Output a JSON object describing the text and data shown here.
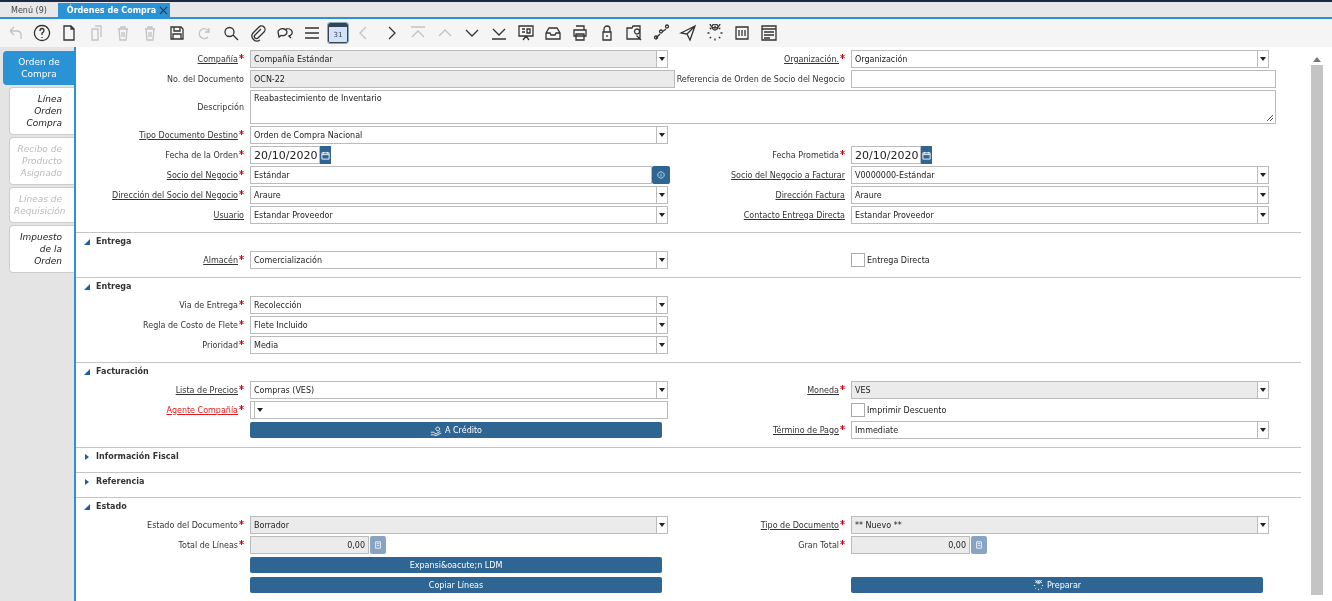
{
  "tabs": [
    {
      "label": "Menú (9)",
      "selected": false
    },
    {
      "label": "Órdenes de Compra",
      "selected": true
    }
  ],
  "toolbar": [
    {
      "kind": "undo",
      "disabled": true
    },
    {
      "kind": "help",
      "disabled": false
    },
    {
      "kind": "new",
      "disabled": false
    },
    {
      "kind": "copy",
      "disabled": true
    },
    {
      "kind": "delete",
      "disabled": true
    },
    {
      "kind": "delete",
      "disabled": true
    },
    {
      "kind": "save",
      "disabled": false
    },
    {
      "kind": "refresh",
      "disabled": true
    },
    {
      "kind": "find",
      "disabled": false
    },
    {
      "kind": "attach",
      "disabled": false
    },
    {
      "kind": "chat",
      "disabled": false
    },
    {
      "kind": "lines",
      "disabled": false
    },
    {
      "kind": "calendar",
      "disabled": false,
      "active": true,
      "label": "31"
    },
    {
      "kind": "prev",
      "disabled": true
    },
    {
      "kind": "next",
      "disabled": false
    },
    {
      "kind": "first",
      "disabled": true
    },
    {
      "kind": "up",
      "disabled": true
    },
    {
      "kind": "down",
      "disabled": false
    },
    {
      "kind": "last",
      "disabled": false
    },
    {
      "kind": "report",
      "disabled": false
    },
    {
      "kind": "archive",
      "disabled": false
    },
    {
      "kind": "print",
      "disabled": false
    },
    {
      "kind": "lock",
      "disabled": false
    },
    {
      "kind": "zoom",
      "disabled": false
    },
    {
      "kind": "workflow",
      "disabled": false
    },
    {
      "kind": "send",
      "disabled": false
    },
    {
      "kind": "gear",
      "disabled": false
    },
    {
      "kind": "product",
      "disabled": false
    },
    {
      "kind": "window",
      "disabled": false
    }
  ],
  "side_tabs": [
    {
      "label": "Orden de Compra",
      "selected": true,
      "disabled": false
    },
    {
      "label": "Línea Orden Compra",
      "selected": false,
      "disabled": false
    },
    {
      "label": "Recibo de Producto Asignado",
      "selected": false,
      "disabled": true
    },
    {
      "label": "Líneas de Requisición",
      "selected": false,
      "disabled": true
    },
    {
      "label": "Impuesto de la Orden",
      "selected": false,
      "disabled": false
    }
  ],
  "sections": [
    {
      "rows": [
        {
          "left": {
            "label": "Compañía",
            "required": true,
            "link": true,
            "kind": "select",
            "value": "Compañía Estándar",
            "readonly": true
          },
          "right": {
            "label": "Organización.",
            "required": true,
            "link": true,
            "kind": "select",
            "value": "Organización",
            "readonly": false
          }
        },
        {
          "left": {
            "label": "No. del Documento",
            "required": false,
            "link": false,
            "kind": "text",
            "value": "OCN-22",
            "readonly": true
          },
          "right": {
            "label": "Referencia de Orden de Socio del Negocio",
            "required": false,
            "link": false,
            "kind": "text",
            "readonly": false
          }
        },
        {
          "left": {
            "label": "Descripción",
            "required": false,
            "link": false,
            "kind": "textarea",
            "value": "Reabastecimiento de Inventario",
            "readonly": false
          }
        },
        {
          "left": {
            "label": "Tipo Documento Destino",
            "required": true,
            "link": true,
            "kind": "select",
            "value": "Orden de Compra Nacional",
            "readonly": false
          }
        },
        {
          "left": {
            "label": "Fecha de la Orden",
            "required": true,
            "link": false,
            "kind": "date",
            "value": "20/10/2020",
            "readonly": false
          },
          "right": {
            "label": "Fecha Prometida",
            "required": true,
            "link": false,
            "kind": "date",
            "value": "20/10/2020",
            "readonly": false
          }
        },
        {
          "left": {
            "label": "Socio del Negocio",
            "required": true,
            "link": true,
            "kind": "search",
            "value": "Estándar",
            "readonly": false
          },
          "right": {
            "label": "Socio del Negocio a Facturar",
            "required": false,
            "link": true,
            "kind": "select",
            "value": "V0000000-Estándar",
            "readonly": false
          }
        },
        {
          "left": {
            "label": "Dirección del Socio del Negocio",
            "required": true,
            "link": true,
            "kind": "select",
            "value": "Araure",
            "readonly": false
          },
          "right": {
            "label": "Dirección Factura",
            "required": false,
            "link": true,
            "kind": "select",
            "value": "Araure",
            "readonly": false
          }
        },
        {
          "left": {
            "label": "Usuario",
            "required": false,
            "link": true,
            "kind": "select",
            "value": "Estandar Proveedor",
            "readonly": false
          },
          "right": {
            "label": "Contacto Entrega Directa",
            "required": false,
            "link": true,
            "kind": "select",
            "value": "Estandar Proveedor",
            "readonly": false
          }
        }
      ]
    },
    {
      "title": "Entrega",
      "expanded": true,
      "rows": [
        {
          "left": {
            "label": "Almacén",
            "required": true,
            "link": true,
            "kind": "select",
            "value": "Comercialización",
            "readonly": false
          },
          "right": {
            "label": "Entrega Directa",
            "kind": "checkbox",
            "checked": false
          }
        }
      ]
    },
    {
      "title": "Entrega",
      "expanded": true,
      "rows": [
        {
          "left": {
            "label": "Via de Entrega",
            "required": true,
            "link": false,
            "kind": "select",
            "value": "Recolección",
            "readonly": false
          }
        },
        {
          "left": {
            "label": "Regla de Costo de Flete",
            "required": true,
            "link": false,
            "kind": "select",
            "value": "Flete Incluido",
            "readonly": false
          }
        },
        {
          "left": {
            "label": "Prioridad",
            "required": true,
            "link": false,
            "kind": "select",
            "value": "Media",
            "readonly": false
          }
        }
      ]
    },
    {
      "title": "Facturación",
      "expanded": true,
      "rows": [
        {
          "left": {
            "label": "Lista de Precios",
            "required": true,
            "link": true,
            "kind": "select",
            "value": "Compras (VES)",
            "readonly": false
          },
          "right": {
            "label": "Moneda",
            "required": true,
            "link": true,
            "kind": "select",
            "value": "VES",
            "readonly": true
          }
        },
        {
          "left": {
            "label": "Agente Compañía",
            "required": true,
            "link": true,
            "error": true,
            "kind": "select",
            "readonly": false
          },
          "right": {
            "label": "Imprimir Descuento",
            "kind": "checkbox",
            "checked": false
          }
        },
        {
          "left": {
            "label": "A Crédito",
            "kind": "paybutton"
          },
          "right": {
            "label": "Término de Pago",
            "required": true,
            "link": true,
            "kind": "select",
            "value": "Immediate",
            "readonly": false
          }
        }
      ]
    },
    {
      "title": "Información Fiscal",
      "expanded": false
    },
    {
      "title": "Referencia",
      "expanded": false
    },
    {
      "title": "Estado",
      "expanded": true,
      "rows": [
        {
          "left": {
            "label": "Estado del Documento",
            "required": true,
            "link": false,
            "kind": "select",
            "value": "Borrador",
            "readonly": true
          },
          "right": {
            "label": "Tipo de Documento",
            "required": true,
            "link": true,
            "kind": "select",
            "value": "** Nuevo **",
            "readonly": true
          }
        },
        {
          "left": {
            "label": "Total de Líneas",
            "required": true,
            "link": false,
            "kind": "number",
            "value": "0,00",
            "readonly": true
          },
          "right": {
            "label": "Gran Total",
            "required": true,
            "link": false,
            "kind": "number",
            "value": "0,00",
            "readonly": true
          }
        },
        {
          "left": {
            "label": "Expansi&oacute;n LDM",
            "kind": "button"
          }
        },
        {
          "left": {
            "label": "Copiar Líneas",
            "kind": "button"
          },
          "right": {
            "label": "Preparar",
            "kind": "processbutton"
          }
        }
      ]
    }
  ]
}
